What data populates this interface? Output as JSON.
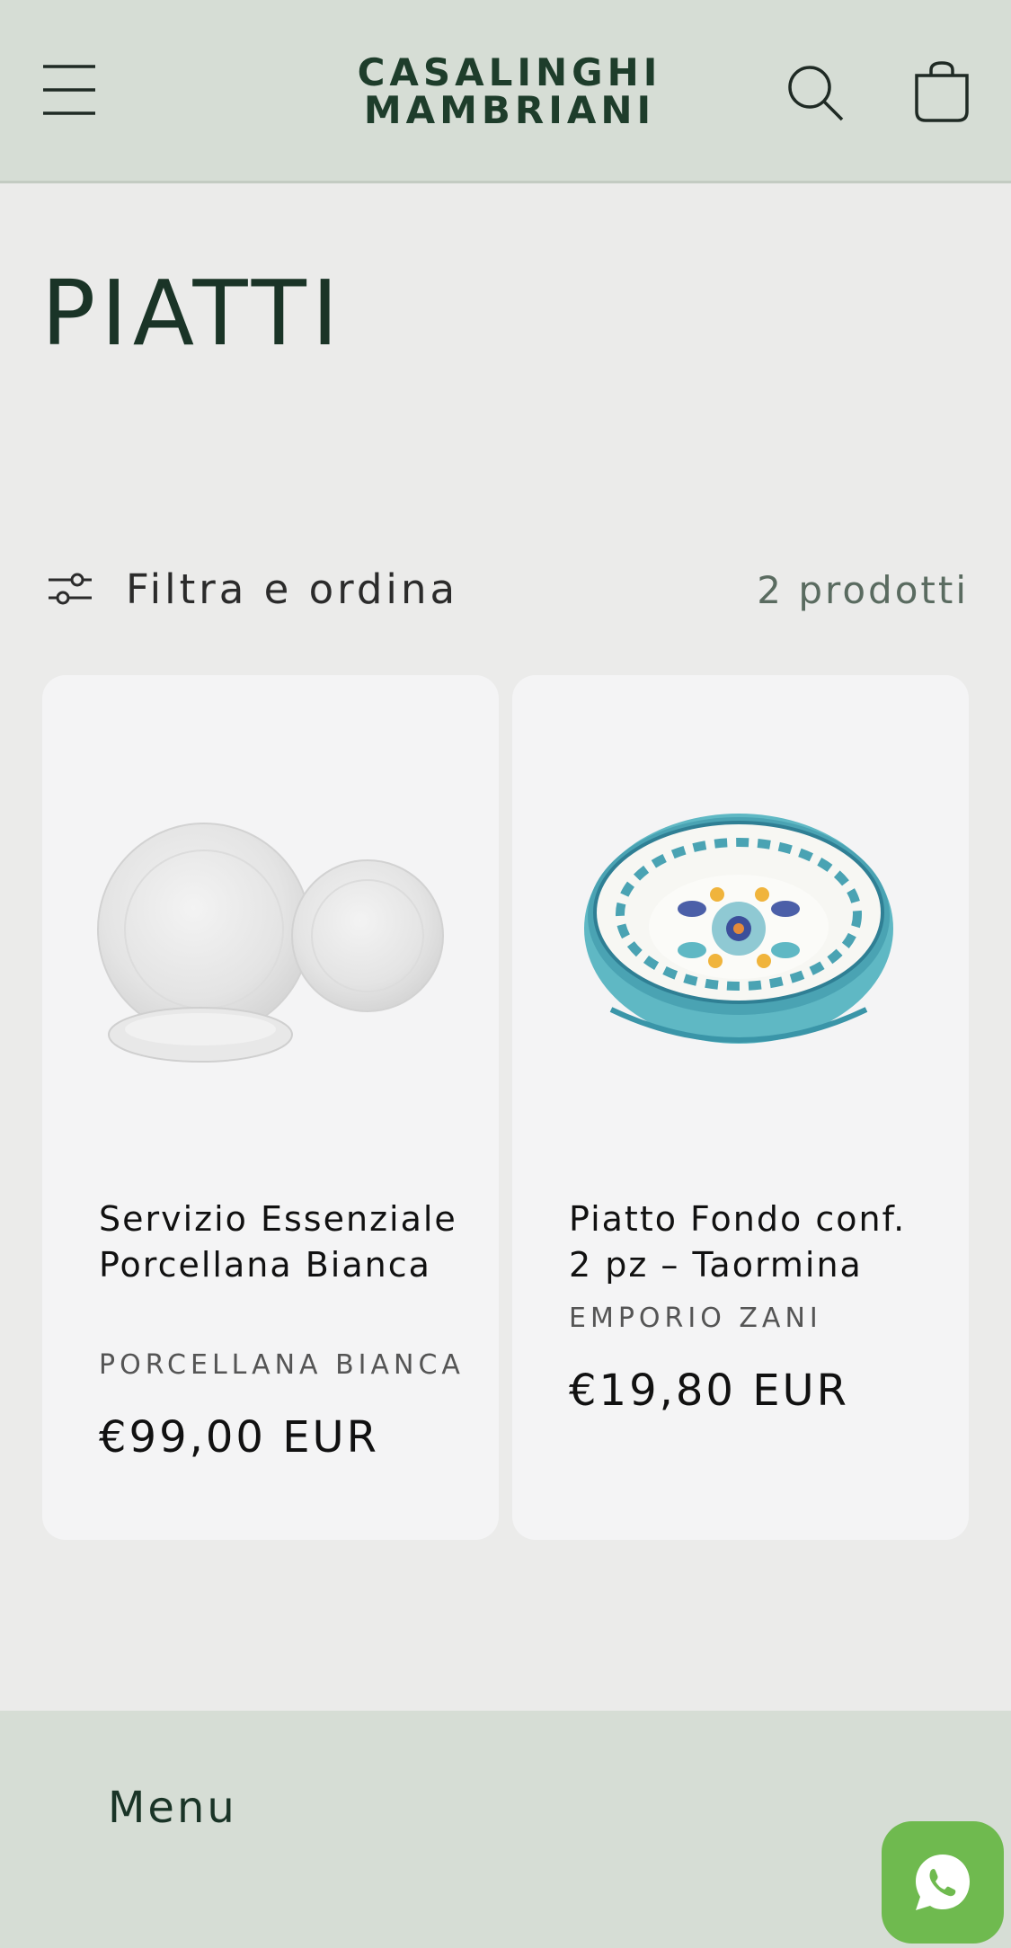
{
  "header": {
    "logo_line1": "CASALINGHI",
    "logo_line2": "MAMBRIANI",
    "menu_icon": "hamburger-menu-icon",
    "search_icon": "search-icon",
    "cart_icon": "shopping-bag-icon"
  },
  "collection": {
    "title": "PIATTI",
    "filter_label": "Filtra e ordina",
    "filter_icon": "sliders-icon",
    "product_count": "2 prodotti"
  },
  "products": [
    {
      "title": "Servizio Essenziale Porcellana Bianca",
      "vendor": "PORCELLANA BIANCA",
      "price": "€99,00 EUR",
      "image": "white-porcelain-plates-image"
    },
    {
      "title": "Piatto Fondo conf. 2 pz – Taormina",
      "vendor": "EMPORIO ZANI",
      "price": "€19,80 EUR",
      "image": "decorated-turquoise-bowl-image"
    }
  ],
  "footer": {
    "menu_label": "Menu"
  },
  "whatsapp": {
    "icon": "whatsapp-icon"
  },
  "colors": {
    "header_bg": "#d6ddd5",
    "page_bg": "#ebebea",
    "card_bg": "#f4f4f5",
    "brand_green": "#1e3d2b",
    "whatsapp_green": "#6fba4f"
  }
}
